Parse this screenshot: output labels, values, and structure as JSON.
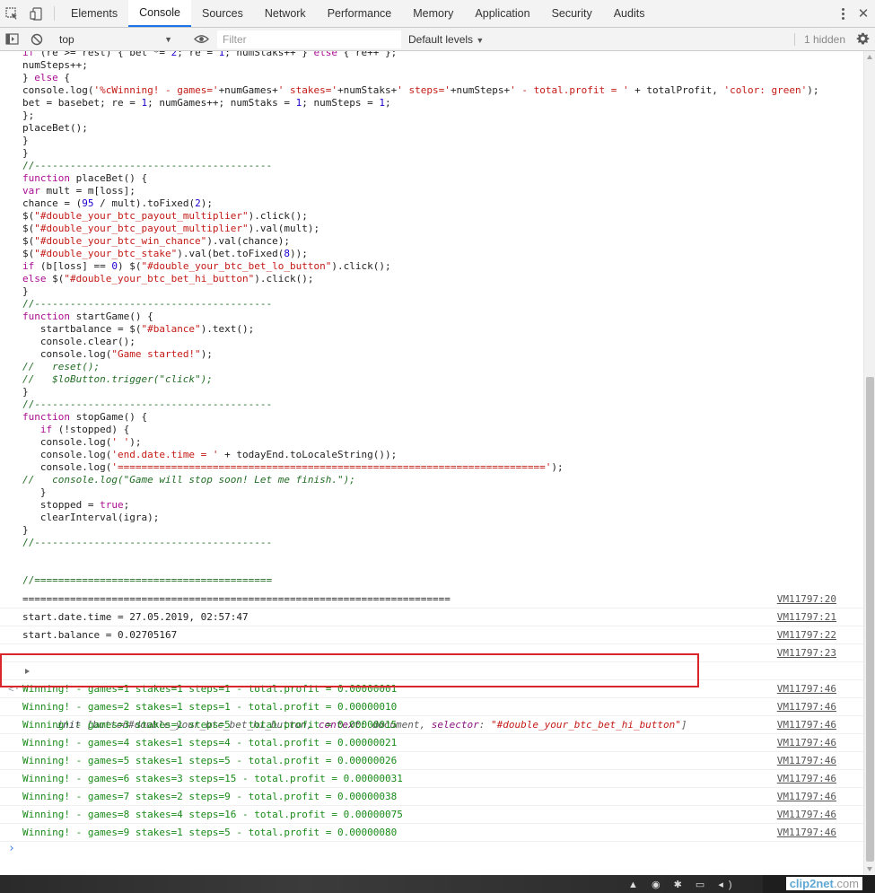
{
  "tabs": [
    "Elements",
    "Console",
    "Sources",
    "Network",
    "Performance",
    "Memory",
    "Application",
    "Security",
    "Audits"
  ],
  "toolbar": {
    "context": "top",
    "filter_placeholder": "Filter",
    "levels": "Default levels",
    "hidden": "1 hidden"
  },
  "code_lines": [
    "if (re >= rest) { bet *= 2; re = 1; numStaks++ } else { re++ };",
    "numSteps++;",
    "} else {",
    "console.log('%cWinning! - games='+numGames+' stakes='+numStaks+' steps='+numSteps+' - total.profit = ' + totalProfit, 'color: green');",
    "bet = basebet; re = 1; numGames++; numStaks = 1; numSteps = 1;",
    "};",
    "placeBet();",
    "}",
    "}",
    "//----------------------------------------",
    "function placeBet() {",
    "var mult = m[loss];",
    "chance = (95 / mult).toFixed(2);",
    "$(\"#double_your_btc_payout_multiplier\").click();",
    "$(\"#double_your_btc_payout_multiplier\").val(mult);",
    "$(\"#double_your_btc_win_chance\").val(chance);",
    "$(\"#double_your_btc_stake\").val(bet.toFixed(8));",
    "if (b[loss] == 0) $(\"#double_your_btc_bet_lo_button\").click();",
    "else $(\"#double_your_btc_bet_hi_button\").click();",
    "}",
    "//----------------------------------------",
    "function startGame() {",
    "   startbalance = $(\"#balance\").text();",
    "   console.clear();",
    "   console.log(\"Game started!\");",
    "//   reset();",
    "//   $loButton.trigger(\"click\");",
    "}",
    "//----------------------------------------",
    "function stopGame() {",
    "   if (!stopped) {",
    "   console.log(' ');",
    "   console.log('end.date.time = ' + todayEnd.toLocaleString());",
    "   console.log('========================================================================');",
    "//   console.log(\"Game will stop soon! Let me finish.\");",
    "   }",
    "   stopped = true;",
    "   clearInterval(igra);",
    "}",
    "//----------------------------------------",
    "",
    "",
    "//========================================"
  ],
  "messages": [
    {
      "text": "========================================================================",
      "src": "VM11797:20"
    },
    {
      "text": "start.date.time = 27.05.2019, 02:57:47",
      "src": "VM11797:21"
    },
    {
      "text": "start.balance = 0.02705167",
      "src": "VM11797:22"
    },
    {
      "text": "",
      "src": "VM11797:23"
    }
  ],
  "result": {
    "name": "init",
    "obj": "button#double_your_btc_bet_hi_button",
    "context_key": "context",
    "context_val": "document",
    "selector_key": "selector",
    "selector_val": "\"#double_your_btc_bet_hi_button\""
  },
  "wins": [
    {
      "text": "Winning! - games=1 stakes=1 steps=1 - total.profit = 0.00000001",
      "src": "VM11797:46"
    },
    {
      "text": "Winning! - games=2 stakes=1 steps=1 - total.profit = 0.00000010",
      "src": "VM11797:46"
    },
    {
      "text": "Winning! - games=3 stakes=1 steps=5 - total.profit = 0.00000015",
      "src": "VM11797:46"
    },
    {
      "text": "Winning! - games=4 stakes=1 steps=4 - total.profit = 0.00000021",
      "src": "VM11797:46"
    },
    {
      "text": "Winning! - games=5 stakes=1 steps=5 - total.profit = 0.00000026",
      "src": "VM11797:46"
    },
    {
      "text": "Winning! - games=6 stakes=3 steps=15 - total.profit = 0.00000031",
      "src": "VM11797:46"
    },
    {
      "text": "Winning! - games=7 stakes=2 steps=9 - total.profit = 0.00000038",
      "src": "VM11797:46"
    },
    {
      "text": "Winning! - games=8 stakes=4 steps=16 - total.profit = 0.00000075",
      "src": "VM11797:46"
    },
    {
      "text": "Winning! - games=9 stakes=1 steps=5 - total.profit = 0.00000080",
      "src": "VM11797:46"
    }
  ],
  "prompt": "›",
  "watermark": {
    "brand": "clip2net",
    "suffix": ".com"
  },
  "colors": {
    "accent": "#1a73e8",
    "highlight": "#d9262b",
    "success": "#1a8a1a"
  }
}
